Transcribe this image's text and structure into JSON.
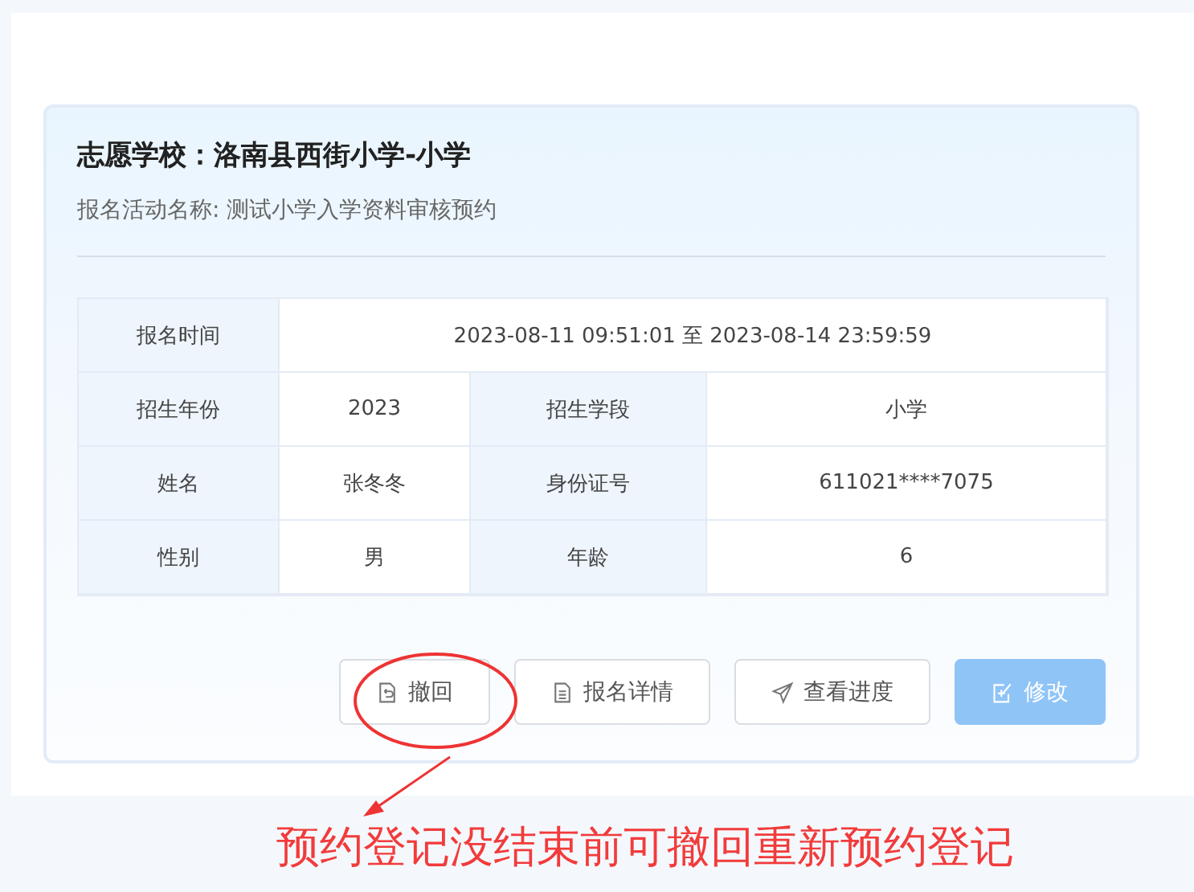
{
  "card": {
    "title": "志愿学校：洛南县西街小学-小学",
    "subtitle": "报名活动名称: 测试小学入学资料审核预约"
  },
  "registration_time": {
    "label": "报名时间",
    "value": "2023-08-11 09:51:01 至 2023-08-14 23:59:59"
  },
  "table": {
    "rows": [
      {
        "cells": [
          {
            "kind": "label",
            "text": "招生年份"
          },
          {
            "kind": "value",
            "text": "2023"
          },
          {
            "kind": "label",
            "text": "招生学段"
          },
          {
            "kind": "value",
            "text": "小学"
          }
        ]
      },
      {
        "cells": [
          {
            "kind": "label",
            "text": "姓名"
          },
          {
            "kind": "value",
            "text": "张冬冬"
          },
          {
            "kind": "label",
            "text": "身份证号"
          },
          {
            "kind": "value",
            "text": "611021****7075"
          }
        ]
      },
      {
        "cells": [
          {
            "kind": "label",
            "text": "性别"
          },
          {
            "kind": "value",
            "text": "男"
          },
          {
            "kind": "label",
            "text": "年龄"
          },
          {
            "kind": "value",
            "text": "6"
          }
        ]
      }
    ]
  },
  "buttons": [
    {
      "kind": "undo",
      "label": "撤回",
      "disabled": false
    },
    {
      "kind": "document",
      "label": "报名详情",
      "disabled": false
    },
    {
      "kind": "send",
      "label": "查看进度",
      "disabled": false
    },
    {
      "kind": "edit",
      "label": "修改",
      "disabled": true
    }
  ],
  "annotation": {
    "text": "预约登记没结束前可撤回重新预约登记"
  }
}
